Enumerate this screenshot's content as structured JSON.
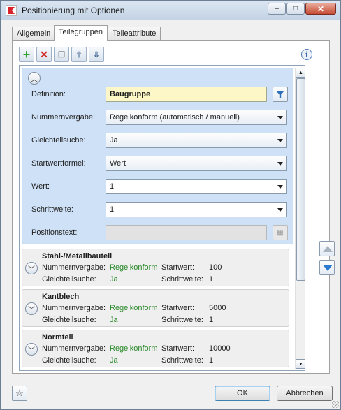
{
  "window": {
    "title": "Positionierung mit Optionen",
    "controls": {
      "minimize": "–",
      "maximize": "□",
      "close": "✕"
    }
  },
  "tabs": [
    {
      "label": "Allgemein",
      "active": false
    },
    {
      "label": "Teilegruppen",
      "active": true
    },
    {
      "label": "Teileattribute",
      "active": false
    }
  ],
  "toolbar": {
    "add": "add-icon",
    "delete": "delete-icon",
    "copy": "copy-icon",
    "import": "import-icon",
    "export": "export-icon",
    "info": "i"
  },
  "definition_panel": {
    "definition": {
      "label": "Definition:",
      "value": "Baugruppe"
    },
    "nummernvergabe": {
      "label": "Nummernvergabe:",
      "value": "Regelkonform (automatisch / manuell)"
    },
    "gleichteilsuche": {
      "label": "Gleichteilsuche:",
      "value": "Ja"
    },
    "startwertformel": {
      "label": "Startwertformel:",
      "value": "Wert"
    },
    "wert": {
      "label": "Wert:",
      "value": "1"
    },
    "schrittweite": {
      "label": "Schrittweite:",
      "value": "1"
    },
    "positionstext": {
      "label": "Positionstext:",
      "value": ""
    }
  },
  "groups": [
    {
      "title": "Stahl-/Metallbauteil",
      "nummernvergabe_label": "Nummernvergabe:",
      "nummernvergabe": "Regelkonform",
      "startwert_label": "Startwert:",
      "startwert": "100",
      "gleichteilsuche_label": "Gleichteilsuche:",
      "gleichteilsuche": "Ja",
      "schrittweite_label": "Schrittweite:",
      "schrittweite": "1"
    },
    {
      "title": "Kantblech",
      "nummernvergabe_label": "Nummernvergabe:",
      "nummernvergabe": "Regelkonform",
      "startwert_label": "Startwert:",
      "startwert": "5000",
      "gleichteilsuche_label": "Gleichteilsuche:",
      "gleichteilsuche": "Ja",
      "schrittweite_label": "Schrittweite:",
      "schrittweite": "1"
    },
    {
      "title": "Normteil",
      "nummernvergabe_label": "Nummernvergabe:",
      "nummernvergabe": "Regelkonform",
      "startwert_label": "Startwert:",
      "startwert": "10000",
      "gleichteilsuche_label": "Gleichteilsuche:",
      "gleichteilsuche": "Ja",
      "schrittweite_label": "Schrittweite:",
      "schrittweite": "1"
    }
  ],
  "buttons": {
    "ok": "OK",
    "cancel": "Abbrechen"
  },
  "colors": {
    "accent_green": "#2b8a2b",
    "panel_blue": "#cfe1f6",
    "definition_bg": "#fdf6c6"
  }
}
